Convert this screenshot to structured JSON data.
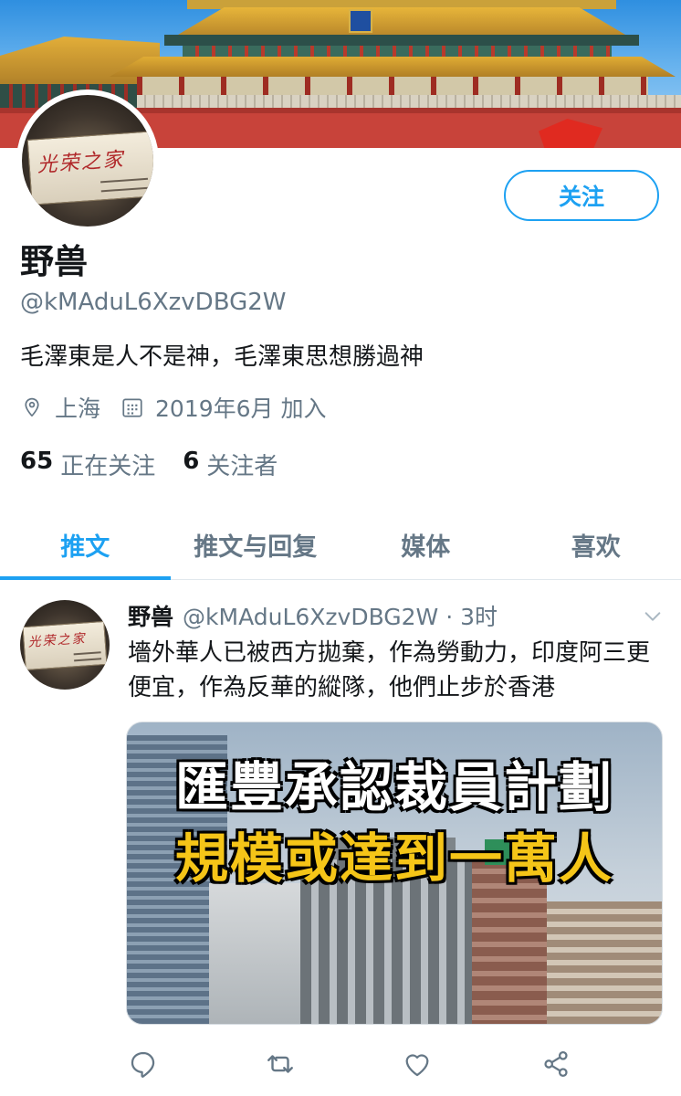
{
  "profile": {
    "avatar_text": "光荣之家",
    "follow_label": "关注",
    "name": "野兽",
    "handle": "@kMAduL6XzvDBG2W",
    "bio": "毛澤東是人不是神，毛澤東思想勝過神",
    "location": "上海",
    "joined": "2019年6月 加入",
    "following_count": "65",
    "following_label": "正在关注",
    "followers_count": "6",
    "followers_label": "关注者"
  },
  "tabs": [
    {
      "label": "推文",
      "active": true
    },
    {
      "label": "推文与回复",
      "active": false
    },
    {
      "label": "媒体",
      "active": false
    },
    {
      "label": "喜欢",
      "active": false
    }
  ],
  "tweet": {
    "name": "野兽",
    "meta": "@kMAduL6XzvDBG2W · 3时",
    "text": "墻外華人已被西方拋棄，作為勞動力，印度阿三更便宜，作為反華的縱隊，他們止步於香港",
    "media_headline_1": "匯豐承認裁員計劃",
    "media_headline_2": "規模或達到一萬人"
  },
  "icons": {
    "location": "location-pin-icon",
    "calendar": "calendar-icon",
    "reply": "reply-icon",
    "retweet": "retweet-icon",
    "like": "heart-icon",
    "share": "share-icon",
    "menu": "chevron-down-icon"
  },
  "colors": {
    "accent": "#1da1f2",
    "secondary_text": "#657786",
    "primary_text": "#14171a",
    "headline_yellow": "#f5c518"
  }
}
